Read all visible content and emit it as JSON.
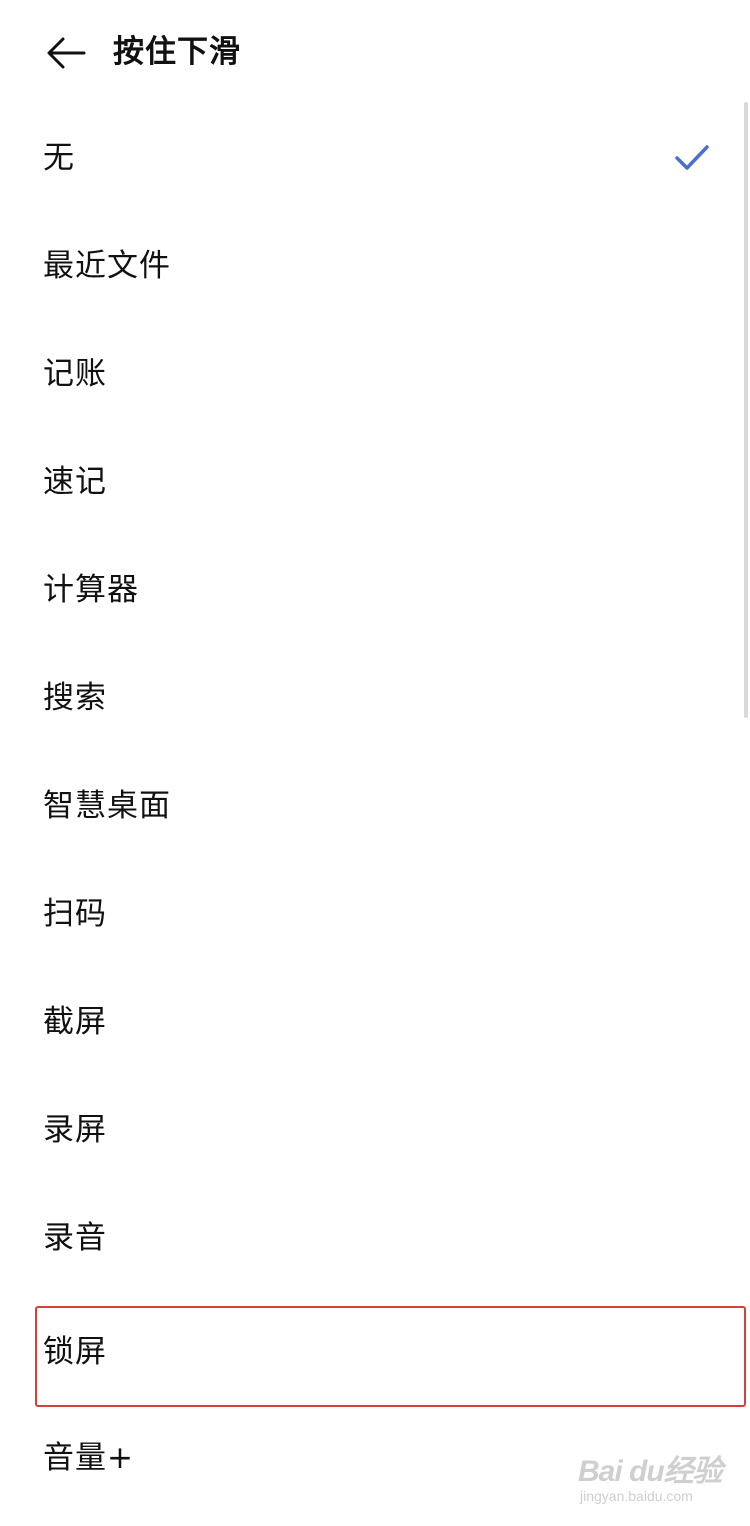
{
  "header": {
    "back_icon": "arrow-left-icon",
    "title": "按住下滑"
  },
  "options": [
    {
      "label": "无",
      "selected": true
    },
    {
      "label": "最近文件",
      "selected": false
    },
    {
      "label": "记账",
      "selected": false
    },
    {
      "label": "速记",
      "selected": false
    },
    {
      "label": "计算器",
      "selected": false
    },
    {
      "label": "搜索",
      "selected": false
    },
    {
      "label": "智慧桌面",
      "selected": false
    },
    {
      "label": "扫码",
      "selected": false
    },
    {
      "label": "截屏",
      "selected": false
    },
    {
      "label": "录屏",
      "selected": false
    },
    {
      "label": "录音",
      "selected": false
    },
    {
      "label": "锁屏",
      "selected": false
    },
    {
      "label": "音量+",
      "selected": false
    }
  ],
  "check_icon": "checkmark-icon",
  "colors": {
    "accent": "#4a6fd1",
    "highlight": "#d0433b",
    "text": "#111111"
  },
  "watermark": {
    "logo_text": "Bai du经验",
    "url": "jingyan.baidu.com"
  }
}
